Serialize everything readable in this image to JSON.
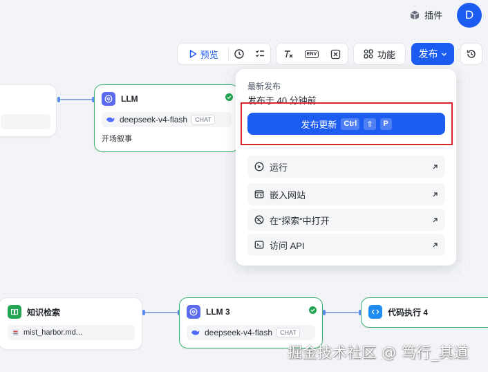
{
  "header": {
    "plugins_label": "插件",
    "avatar_initial": "D"
  },
  "toolbar": {
    "preview_label": "预览",
    "env_label": "ENV",
    "features_label": "功能",
    "publish_label": "发布"
  },
  "nodes": {
    "llm": {
      "title": "LLM",
      "model": "deepseek-v4-flash",
      "tag": "CHAT",
      "output": "开场叙事"
    },
    "kb": {
      "title": "知识检索",
      "file": "mist_harbor.md..."
    },
    "llm3": {
      "title": "LLM 3",
      "model": "deepseek-v4-flash",
      "tag": "CHAT"
    },
    "code": {
      "title": "代码执行 4"
    }
  },
  "publish_panel": {
    "title": "最新发布",
    "time": "发布于 40 分钟前",
    "update_label": "发布更新",
    "shortcut": [
      "Ctrl",
      "⇧",
      "P"
    ],
    "items": [
      {
        "label": "运行",
        "icon": "play-circle-icon"
      },
      {
        "label": "嵌入网站",
        "icon": "embed-icon"
      },
      {
        "label": "在“探索”中打开",
        "icon": "explore-icon"
      },
      {
        "label": "访问 API",
        "icon": "terminal-icon"
      }
    ]
  },
  "watermark": "掘金技术社区 @ 笃行_其道",
  "colors": {
    "accent": "#1d5cf0",
    "success": "#22a653",
    "highlight": "#d9262d"
  }
}
